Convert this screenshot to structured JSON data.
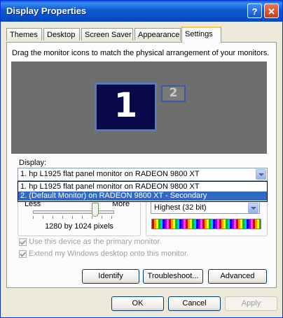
{
  "window": {
    "title": "Display Properties",
    "help_label": "?",
    "close_label": "✕"
  },
  "tabs": [
    {
      "label": "Themes"
    },
    {
      "label": "Desktop"
    },
    {
      "label": "Screen Saver"
    },
    {
      "label": "Appearance"
    },
    {
      "label": "Settings",
      "active": true
    }
  ],
  "settings": {
    "instruction": "Drag the monitor icons to match the physical arrangement of your monitors.",
    "monitors": [
      {
        "number": "1",
        "selected": true
      },
      {
        "number": "2",
        "selected": false
      }
    ],
    "display_label": "Display:",
    "display_value": "1. hp L1925 flat panel monitor on RADEON 9800 XT",
    "dropdown_options": [
      "1. hp L1925 flat panel monitor on RADEON 9800 XT",
      "2. (Default Monitor) on RADEON 9800 XT - Secondary"
    ],
    "dropdown_selected_index": 1,
    "resolution": {
      "less_label": "Less",
      "more_label": "More",
      "value_text": "1280 by 1024 pixels"
    },
    "color_quality": {
      "value": "Highest (32 bit)"
    },
    "checkbox_primary": {
      "label": "Use this device as the primary monitor.",
      "checked": true,
      "enabled": false
    },
    "checkbox_extend": {
      "label": "Extend my Windows desktop onto this monitor.",
      "checked": true,
      "enabled": false
    },
    "buttons": {
      "identify": "Identify",
      "troubleshoot": "Troubleshoot...",
      "advanced": "Advanced"
    }
  },
  "footer": {
    "ok": "OK",
    "cancel": "Cancel",
    "apply": "Apply"
  },
  "colors": {
    "title_bar": "#0a59d0",
    "selection": "#316ac5",
    "monitor_bg": "#0a0a4a",
    "desktop_area": "#6e6e6e"
  }
}
